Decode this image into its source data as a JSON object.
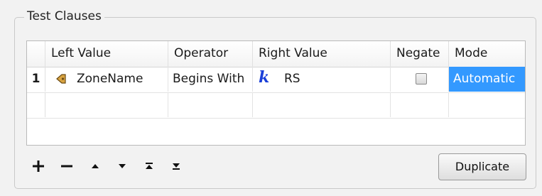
{
  "group": {
    "title": "Test Clauses"
  },
  "table": {
    "headers": [
      "Left Value",
      "Operator",
      "Right Value",
      "Negate",
      "Mode"
    ],
    "rows": [
      {
        "row_number": "1",
        "left_value": "ZoneName",
        "left_icon": "attribute-icon",
        "operator": "Begins With",
        "right_icon": "constant-k-icon",
        "right_value": "RS",
        "negate": false,
        "mode": "Automatic"
      }
    ]
  },
  "toolbar": {
    "buttons": [
      "add",
      "remove",
      "move-up",
      "move-down",
      "move-to-top",
      "move-to-bottom"
    ],
    "duplicate_label": "Duplicate"
  },
  "colors": {
    "selection": "#3399ff",
    "constant_icon": "#1a3fd8"
  }
}
